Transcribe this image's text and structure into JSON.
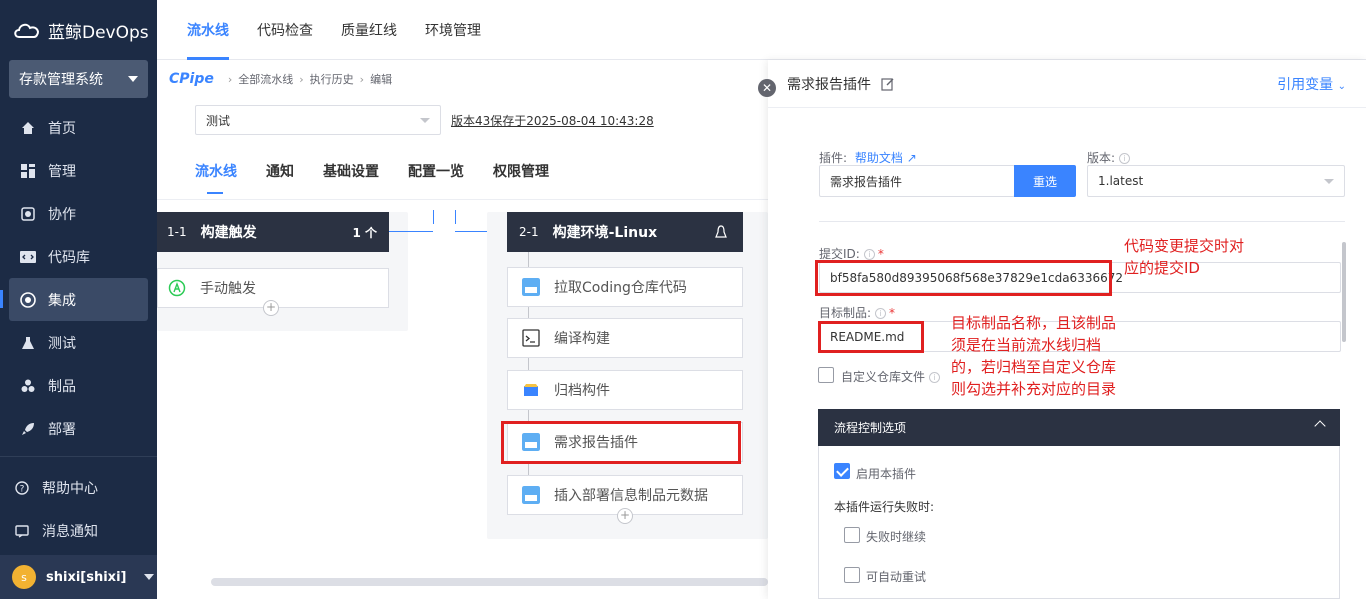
{
  "brand": {
    "name": "蓝鲸DevOps"
  },
  "sidebar": {
    "project": "存款管理系统",
    "items": [
      {
        "label": "首页",
        "icon": "home-icon"
      },
      {
        "label": "管理",
        "icon": "grid-icon"
      },
      {
        "label": "协作",
        "icon": "collab-icon"
      },
      {
        "label": "代码库",
        "icon": "code-icon"
      },
      {
        "label": "集成",
        "icon": "integration-icon"
      },
      {
        "label": "测试",
        "icon": "flask-icon"
      },
      {
        "label": "制品",
        "icon": "artifact-icon"
      },
      {
        "label": "部署",
        "icon": "rocket-icon"
      }
    ],
    "active_index": 4,
    "help": "帮助中心",
    "messages": "消息通知",
    "user": {
      "avatar_letter": "s",
      "name": "shixi[shixi]"
    }
  },
  "topnav": {
    "tabs": [
      "流水线",
      "代码检查",
      "质量红线",
      "环境管理"
    ],
    "active_index": 0
  },
  "breadcrumb": {
    "logo": "CPipe",
    "items": [
      "全部流水线",
      "执行历史",
      "编辑"
    ]
  },
  "toolbar": {
    "pipeline_select": "测试",
    "version_info": "版本43保存于2025-08-04 10:43:28"
  },
  "subtabs": {
    "items": [
      "流水线",
      "通知",
      "基础设置",
      "配置一览",
      "权限管理"
    ],
    "active_index": 0
  },
  "stages": [
    {
      "index": "1-1",
      "title": "构建触发",
      "count": "1 个",
      "atoms": [
        {
          "label": "手动触发",
          "icon": "trigger-icon"
        }
      ]
    },
    {
      "index": "2-1",
      "title": "构建环境-Linux",
      "env_icon": "linux-icon",
      "atoms": [
        {
          "label": "拉取Coding仓库代码",
          "icon": "plugin-icon"
        },
        {
          "label": "编译构建",
          "icon": "terminal-icon"
        },
        {
          "label": "归档构件",
          "icon": "archive-icon"
        },
        {
          "label": "需求报告插件",
          "icon": "plugin-icon"
        },
        {
          "label": "插入部署信息制品元数据",
          "icon": "plugin-icon"
        }
      ]
    }
  ],
  "panel": {
    "title": "需求报告插件",
    "ref_var": "引用变量",
    "plugin_label": "插件:",
    "help_doc": "帮助文档",
    "plugin_value": "需求报告插件",
    "reselect": "重选",
    "version_label": "版本:",
    "version_value": "1.latest",
    "commit_label": "提交ID:",
    "commit_value": "bf58fa580d89395068f568e37829e1cda6336672",
    "artifact_label": "目标制品:",
    "artifact_value": "README.md",
    "custom_repo": "自定义仓库文件",
    "flow_title": "流程控制选项",
    "enable_plugin": "启用本插件",
    "on_fail_label": "本插件运行失败时:",
    "continue_on_fail": "失败时继续",
    "auto_retry": "可自动重试"
  },
  "annotations": {
    "commit_note_1": "代码变更提交时对",
    "commit_note_2": "应的提交ID",
    "artifact_note_1": "目标制品名称，且该制品",
    "artifact_note_2": "须是在当前流水线归档",
    "artifact_note_3": "的，若归档至自定义仓库",
    "artifact_note_4": "则勾选并补充对应的目录"
  },
  "colors": {
    "accent": "#3a84ff",
    "sidebar_bg": "#1c2b45",
    "annotation_red": "#e02020"
  }
}
